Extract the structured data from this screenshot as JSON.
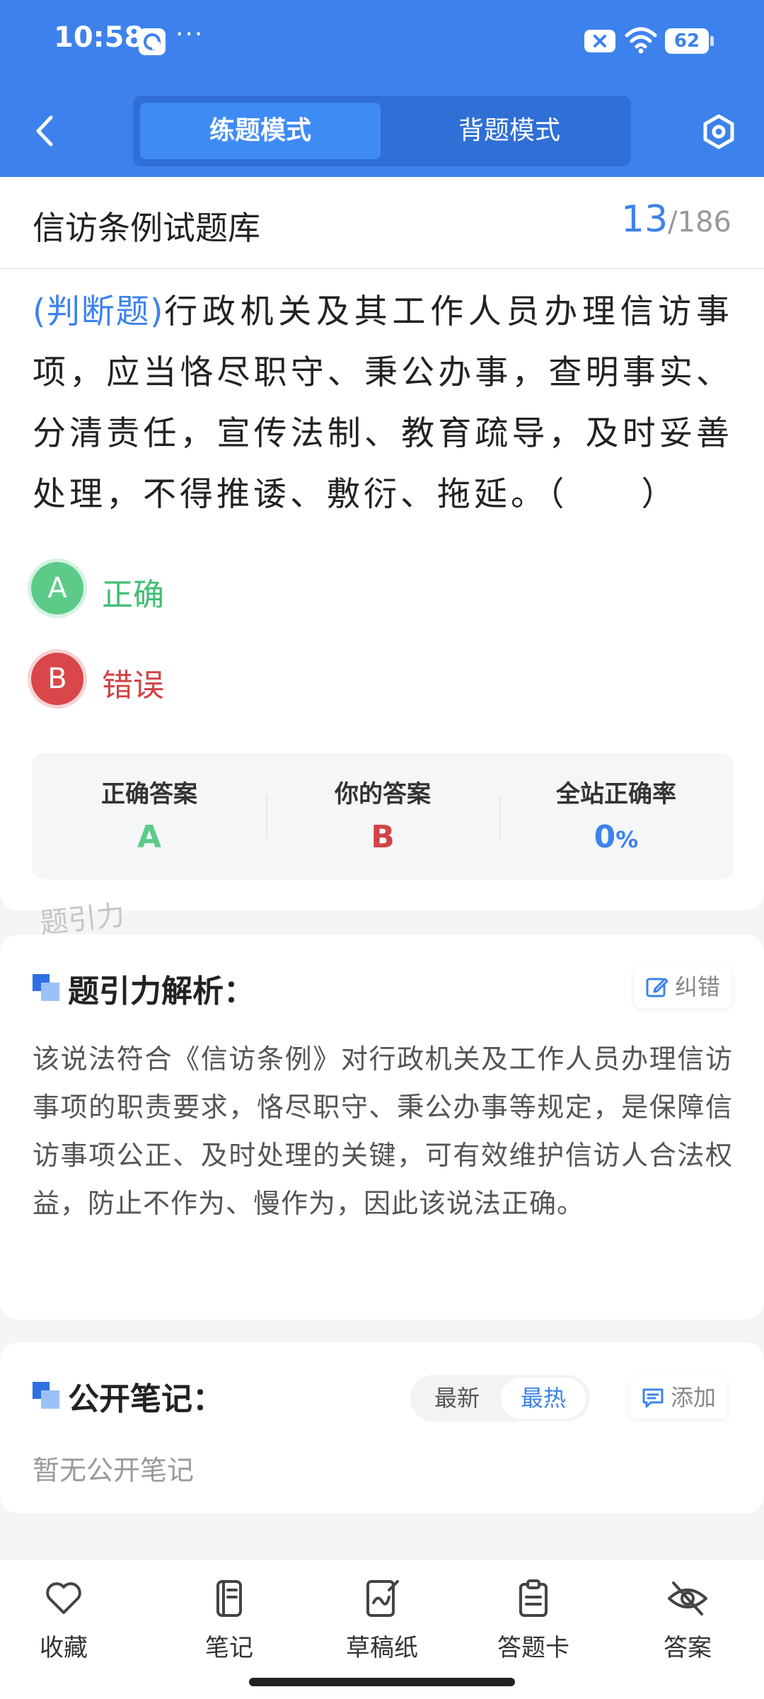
{
  "status": {
    "time": "10:58",
    "dots": "···",
    "battery": "62"
  },
  "header": {
    "mode_practice": "练题模式",
    "mode_memorize": "背题模式"
  },
  "question_card": {
    "bank_title": "信访条例试题库",
    "current": "13",
    "separator": "/",
    "total": "186",
    "type": "(判断题)",
    "text": "行政机关及其工作人员办理信访事项，应当恪尽职守、秉公办事，查明事实、分清责任，宣传法制、教育疏导，及时妥善处理，不得推诿、敷衍、拖延。（　　）",
    "options": [
      {
        "letter": "A",
        "label": "正确"
      },
      {
        "letter": "B",
        "label": "错误"
      }
    ],
    "answer_stats": {
      "correct_label": "正确答案",
      "correct_value": "A",
      "yours_label": "你的答案",
      "yours_value": "B",
      "rate_label": "全站正确率",
      "rate_value": "0",
      "rate_unit": "%"
    },
    "watermark": "题引力"
  },
  "analysis": {
    "title": "题引力解析：",
    "report_label": "纠错",
    "text": "该说法符合《信访条例》对行政机关及工作人员办理信访事项的职责要求，恪尽职守、秉公办事等规定，是保障信访事项公正、及时处理的关键，可有效维护信访人合法权益，防止不作为、慢作为，因此该说法正确。"
  },
  "notes": {
    "title": "公开笔记：",
    "sort_newest": "最新",
    "sort_hottest": "最热",
    "add_label": "添加",
    "empty_text": "暂无公开笔记"
  },
  "bottom_tabs": [
    {
      "icon": "heart-icon",
      "label": "收藏"
    },
    {
      "icon": "notebook-icon",
      "label": "笔记"
    },
    {
      "icon": "draft-icon",
      "label": "草稿纸"
    },
    {
      "icon": "clipboard-icon",
      "label": "答题卡"
    },
    {
      "icon": "eye-off-icon",
      "label": "答案"
    }
  ],
  "colors": {
    "brand_blue": "#3d82ec",
    "correct_green": "#5ccb88",
    "wrong_red": "#d9474a"
  }
}
